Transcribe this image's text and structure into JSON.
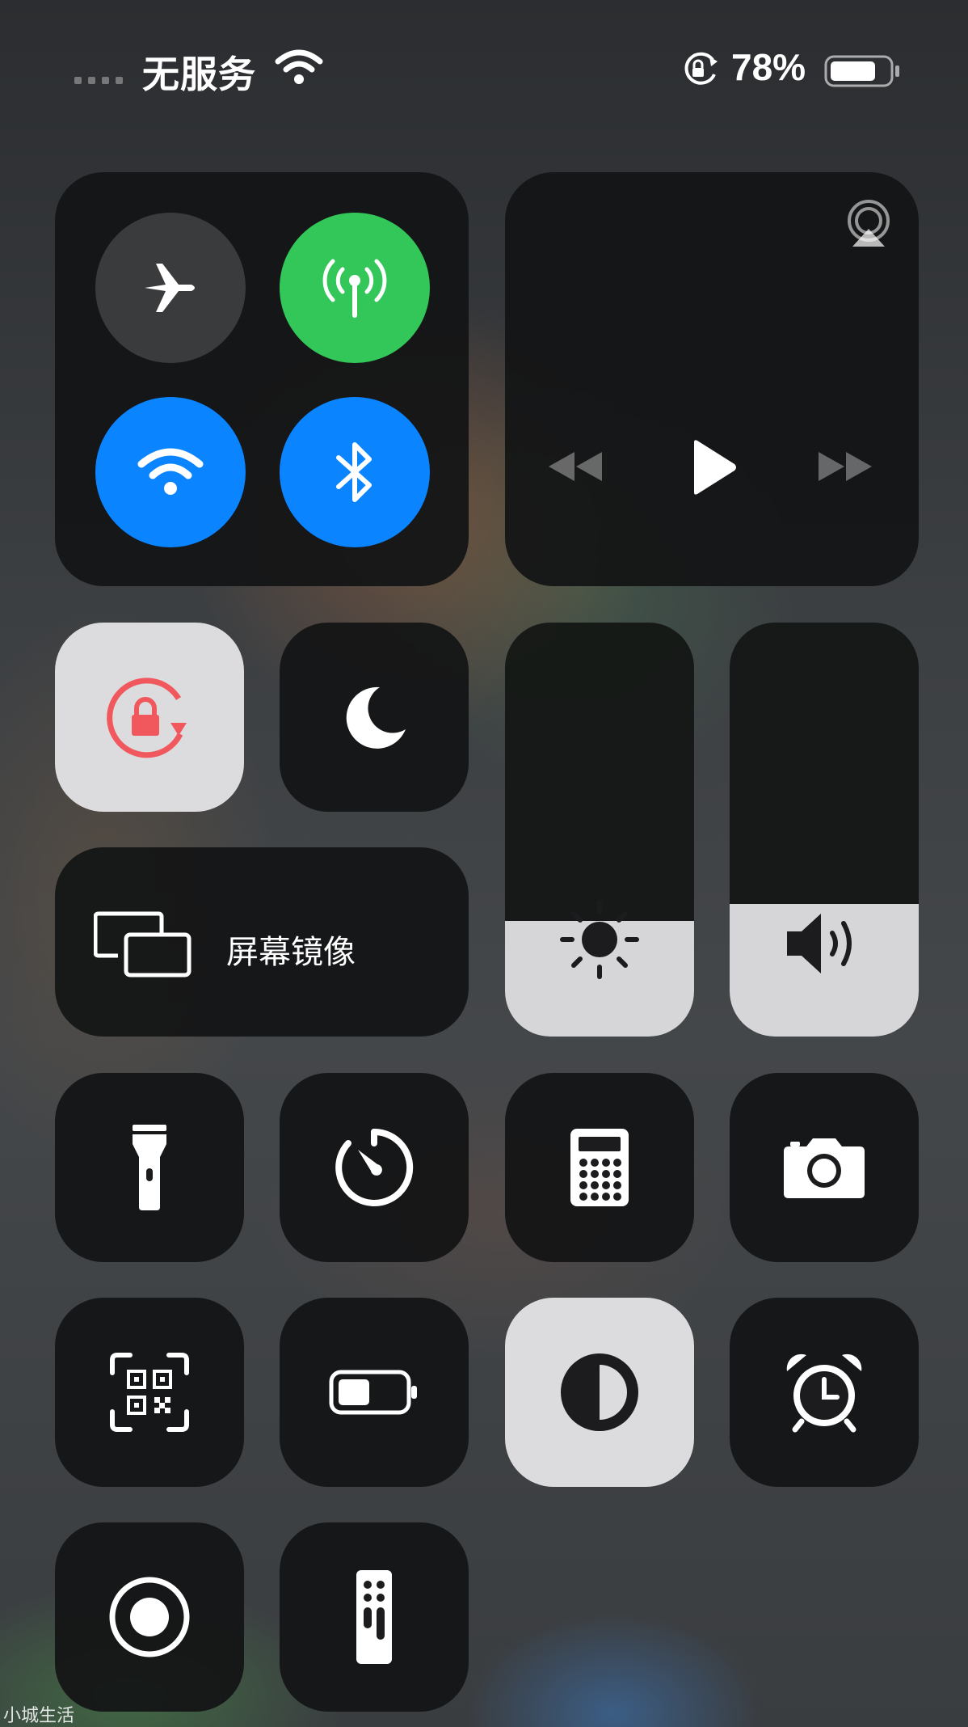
{
  "status_bar": {
    "carrier": "无服务",
    "battery_percent": "78%",
    "battery_level": 0.78
  },
  "connectivity": {
    "airplane": {
      "icon": "airplane-icon",
      "active": false
    },
    "cellular": {
      "icon": "antenna-icon",
      "active": true,
      "color": "#33c759"
    },
    "wifi": {
      "icon": "wifi-icon",
      "active": true,
      "color": "#0a84ff"
    },
    "bluetooth": {
      "icon": "bluetooth-icon",
      "active": true,
      "color": "#0a84ff"
    }
  },
  "media": {
    "icons": [
      "airplay-icon",
      "rewind-icon",
      "play-icon",
      "fast-forward-icon"
    ]
  },
  "toggles": {
    "orientation_lock": {
      "icon": "orientation-lock-icon",
      "active": true,
      "color": "#f0585e"
    },
    "do_not_disturb": {
      "icon": "moon-icon",
      "active": false
    }
  },
  "screen_mirroring": {
    "label": "屏幕镜像",
    "icon": "screen-mirroring-icon"
  },
  "sliders": {
    "brightness": {
      "icon": "sun-icon",
      "level": 0.28
    },
    "volume": {
      "icon": "speaker-icon",
      "level": 0.32
    }
  },
  "shortcuts": [
    {
      "name": "flashlight",
      "icon": "flashlight-icon"
    },
    {
      "name": "timer",
      "icon": "timer-icon"
    },
    {
      "name": "calculator",
      "icon": "calculator-icon"
    },
    {
      "name": "camera",
      "icon": "camera-icon"
    },
    {
      "name": "qr-scanner",
      "icon": "qr-code-icon"
    },
    {
      "name": "low-power-mode",
      "icon": "battery-icon"
    },
    {
      "name": "dark-mode",
      "icon": "dark-mode-icon",
      "active": true
    },
    {
      "name": "alarm",
      "icon": "alarm-icon"
    },
    {
      "name": "screen-recording",
      "icon": "record-icon"
    },
    {
      "name": "apple-tv-remote",
      "icon": "remote-icon"
    }
  ],
  "watermark": "小城生活"
}
